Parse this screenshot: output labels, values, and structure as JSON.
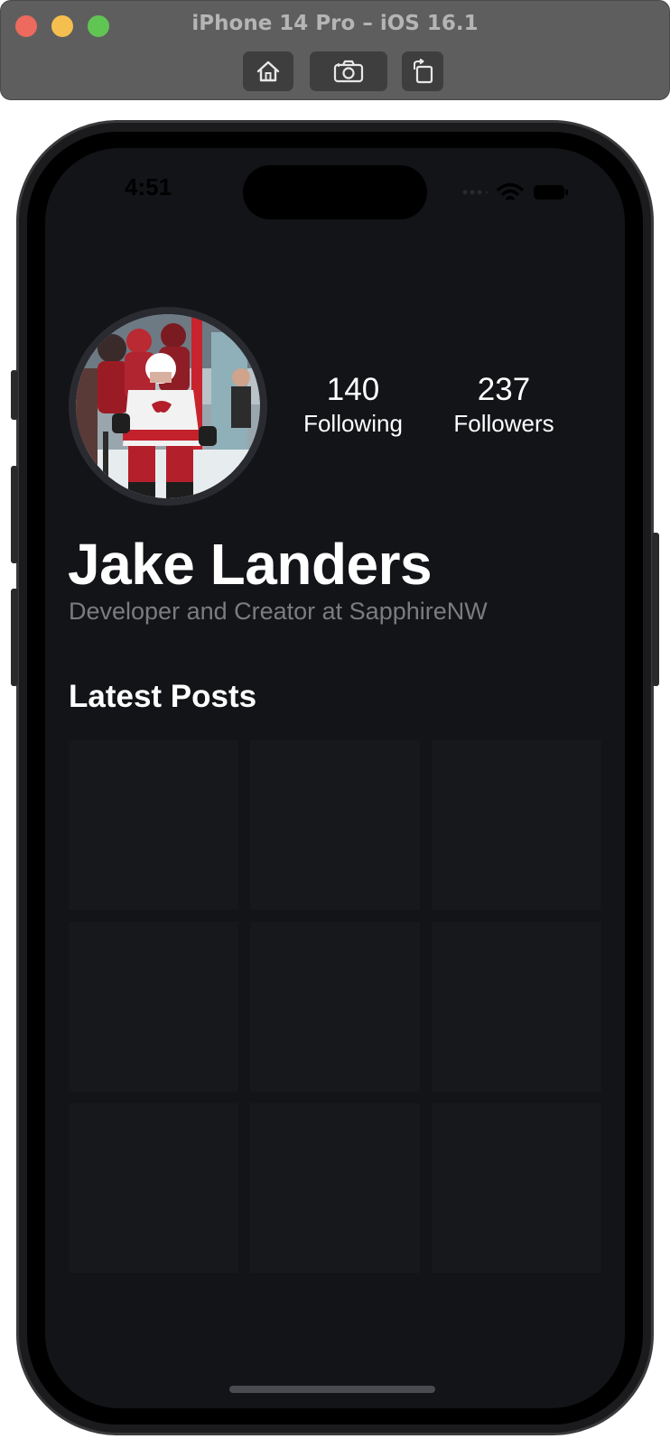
{
  "window": {
    "title": "iPhone 14 Pro – iOS 16.1",
    "toolbar": {
      "home": "house-icon",
      "screenshot": "camera-icon",
      "rotate": "rotate-icon"
    }
  },
  "status_bar": {
    "time": "4:51",
    "icons": [
      "signal-dots-icon",
      "wifi-icon",
      "battery-icon"
    ]
  },
  "profile": {
    "name": "Jake Landers",
    "bio": "Developer and Creator at SapphireNW",
    "avatar": "profile-photo",
    "stats": {
      "following_count": "140",
      "following_label": "Following",
      "followers_count": "237",
      "followers_label": "Followers"
    }
  },
  "posts": {
    "title": "Latest Posts",
    "tiles": 9
  },
  "colors": {
    "background": "#131417",
    "tile": "#17181c",
    "text_primary": "#ffffff",
    "text_secondary": "#7b7c80"
  }
}
